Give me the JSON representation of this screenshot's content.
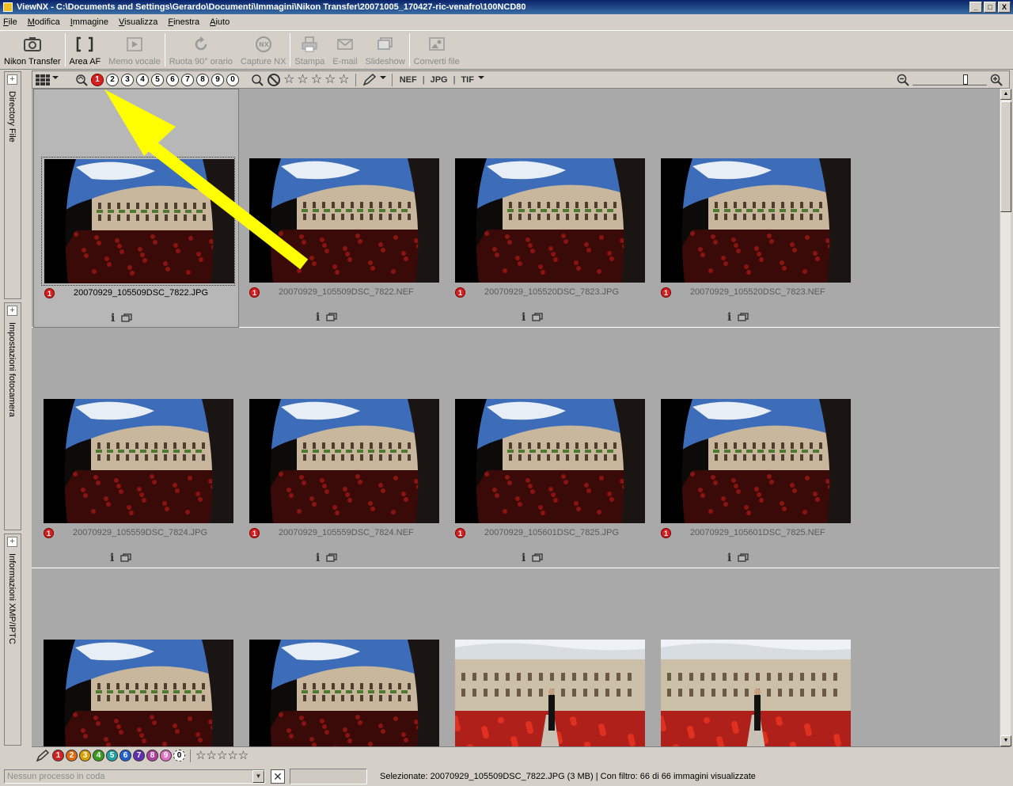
{
  "window": {
    "title": "ViewNX - C:\\Documents and Settings\\Gerardo\\Documenti\\Immagini\\Nikon Transfer\\20071005_170427-ric-venafro\\100NCD80",
    "min_label": "_",
    "max_label": "□",
    "close_label": "X"
  },
  "menu": [
    "File",
    "Modifica",
    "Immagine",
    "Visualizza",
    "Finestra",
    "Aiuto"
  ],
  "toolbar": {
    "nikon_transfer": "Nikon Transfer",
    "area_af": "Area AF",
    "memo_vocale": "Memo vocale",
    "ruota": "Ruota 90° orario",
    "capture_nx": "Capture NX",
    "stampa": "Stampa",
    "email": "E-mail",
    "slideshow": "Slideshow",
    "converti": "Converti file"
  },
  "side": {
    "directory": "Directory File",
    "impostazioni": "Impostazioni fotocamera",
    "informazioni": "Informazioni XMP/IPTC",
    "plus": "+"
  },
  "filterbar": {
    "labels": [
      "1",
      "2",
      "3",
      "4",
      "5",
      "6",
      "7",
      "8",
      "9",
      "0"
    ],
    "formats": [
      "NEF",
      "JPG",
      "TIF"
    ],
    "sep": "|"
  },
  "thumbnails": [
    {
      "name": "20070929_105509DSC_7822.JPG",
      "badge": "1",
      "selected": true,
      "scene": "dark"
    },
    {
      "name": "20070929_105509DSC_7822.NEF",
      "badge": "1",
      "scene": "dark"
    },
    {
      "name": "20070929_105520DSC_7823.JPG",
      "badge": "1",
      "scene": "dark"
    },
    {
      "name": "20070929_105520DSC_7823.NEF",
      "badge": "1",
      "scene": "dark"
    },
    {
      "name": "20070929_105559DSC_7824.JPG",
      "badge": "1",
      "scene": "dark"
    },
    {
      "name": "20070929_105559DSC_7824.NEF",
      "badge": "1",
      "scene": "dark"
    },
    {
      "name": "20070929_105601DSC_7825.JPG",
      "badge": "1",
      "scene": "dark"
    },
    {
      "name": "20070929_105601DSC_7825.NEF",
      "badge": "1",
      "scene": "dark"
    },
    {
      "name": "",
      "badge": "",
      "scene": "dark"
    },
    {
      "name": "",
      "badge": "",
      "scene": "dark"
    },
    {
      "name": "",
      "badge": "",
      "scene": "bright"
    },
    {
      "name": "",
      "badge": "",
      "scene": "bright"
    }
  ],
  "info_icon": "i",
  "bottom": {
    "labels": [
      {
        "n": "1",
        "color": "#d42020"
      },
      {
        "n": "2",
        "color": "#e06a10"
      },
      {
        "n": "3",
        "color": "#d8a000"
      },
      {
        "n": "4",
        "color": "#3a9a20"
      },
      {
        "n": "5",
        "color": "#20a0a0"
      },
      {
        "n": "6",
        "color": "#2060d0"
      },
      {
        "n": "7",
        "color": "#6030b0"
      },
      {
        "n": "8",
        "color": "#b040a0"
      },
      {
        "n": "9",
        "color": "#e070c0"
      },
      {
        "n": "0",
        "color": "#ffffff"
      }
    ],
    "stars": "☆☆☆☆☆"
  },
  "status": {
    "queue_placeholder": "Nessun processo in coda",
    "close": "✕",
    "selection": "Selezionate: 20070929_105509DSC_7822.JPG (3 MB) | Con filtro: 66 di 66 immagini visualizzate"
  }
}
